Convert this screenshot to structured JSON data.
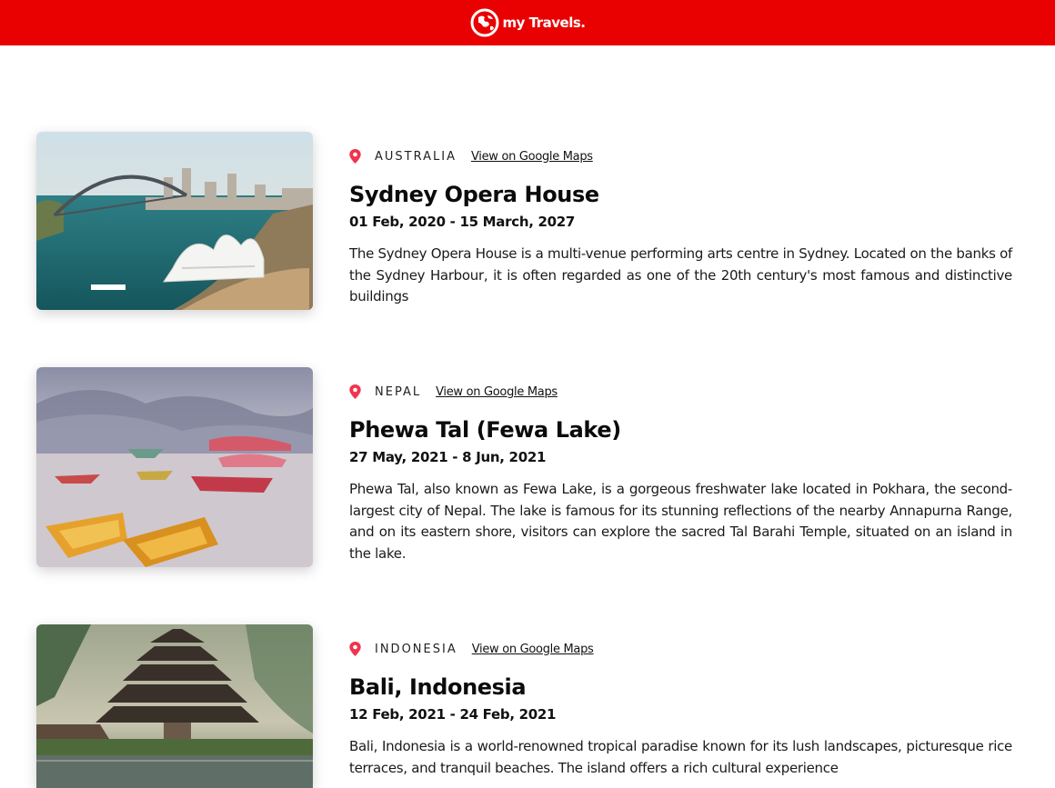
{
  "header": {
    "brand_name": "my Travels.",
    "brand_color": "#e90000",
    "logo_icon": "globe-icon"
  },
  "entries": [
    {
      "country": "AUSTRALIA",
      "maps_link": "View on Google Maps",
      "title": "Sydney Opera House",
      "dates": "01 Feb, 2020 - 15 March, 2027",
      "description": "The Sydney Opera House is a multi-venue performing arts centre in Sydney. Located on the banks of the Sydney Harbour, it is often regarded as one of the 20th century's most famous and distinctive buildings",
      "image": "sydney-opera-house-photo"
    },
    {
      "country": "NEPAL",
      "maps_link": "View on Google Maps",
      "title": "Phewa Tal (Fewa Lake)",
      "dates": "27 May, 2021 - 8 Jun, 2021",
      "description": "Phewa Tal, also known as Fewa Lake, is a gorgeous freshwater lake located in Pokhara, the second-largest city of Nepal. The lake is famous for its stunning reflections of the nearby Annapurna Range, and on its eastern shore, visitors can explore the sacred Tal Barahi Temple, situated on an island in the lake.",
      "image": "fewa-lake-boats-photo"
    },
    {
      "country": "INDONESIA",
      "maps_link": "View on Google Maps",
      "title": "Bali, Indonesia",
      "dates": "12 Feb, 2021 - 24 Feb, 2021",
      "description": "Bali, Indonesia is a world-renowned tropical paradise known for its lush landscapes, picturesque rice terraces, and tranquil beaches. The island offers a rich cultural experience",
      "image": "bali-temple-photo"
    }
  ],
  "pin_color": "#f0344d"
}
